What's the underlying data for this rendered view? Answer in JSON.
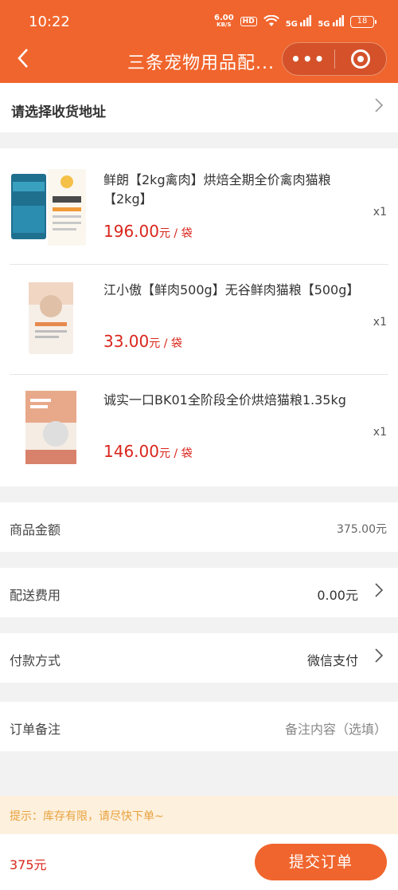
{
  "status_bar": {
    "time": "10:22",
    "net_speed": "6.00",
    "net_unit": "KB/S",
    "hd": "HD",
    "sig1": "5G",
    "sig2": "5G",
    "battery": "18"
  },
  "nav": {
    "title": "三条宠物用品配...",
    "back_icon": "chevron-left",
    "more_icon": "more-dots",
    "close_icon": "target-circle"
  },
  "address": {
    "label": "请选择收货地址"
  },
  "products": [
    {
      "name": "鲜朗【2kg禽肉】烘焙全期全价禽肉猫粮【2kg】",
      "price": "196.00",
      "unit": "元 / 袋",
      "qty": "x1"
    },
    {
      "name": "江小傲【鲜肉500g】无谷鲜肉猫粮【500g】",
      "price": "33.00",
      "unit": "元 / 袋",
      "qty": "x1"
    },
    {
      "name": "诚实一口BK01全阶段全价烘焙猫粮1.35kg",
      "price": "146.00",
      "unit": "元 / 袋",
      "qty": "x1"
    }
  ],
  "summary": {
    "goods_label": "商品金额",
    "goods_value": "375.00元",
    "delivery_label": "配送费用",
    "delivery_value": "0.00元",
    "payment_label": "付款方式",
    "payment_value": "微信支付",
    "remark_label": "订单备注",
    "remark_placeholder": "备注内容（选填）"
  },
  "tip": "提示：库存有限，请尽快下单~",
  "bottom": {
    "total": "375元",
    "submit_label": "提交订单"
  },
  "colors": {
    "brand": "#f0652d",
    "price": "#d9261c",
    "tip_text": "#e8a23e",
    "tip_bg": "#fdf0dd"
  }
}
